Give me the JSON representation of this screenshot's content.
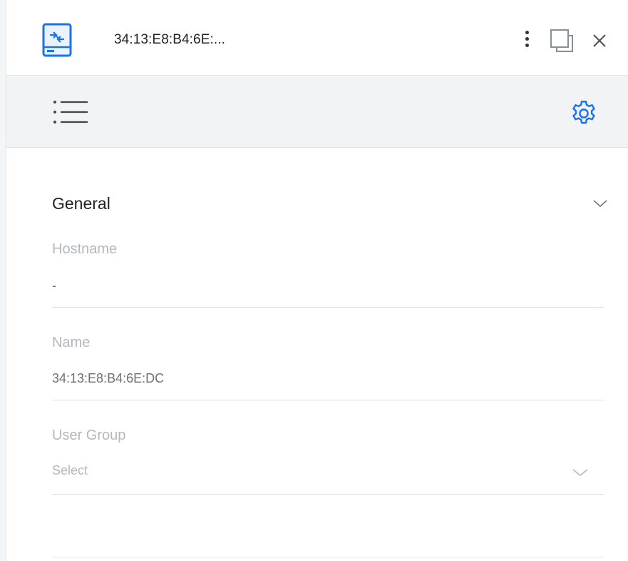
{
  "header": {
    "title": "34:13:E8:B4:6E:...",
    "device_icon": "network-device-icon",
    "menu_icon": "kebab-menu-icon",
    "restore_icon": "restore-window-icon",
    "close_icon": "close-icon"
  },
  "toolbar": {
    "list_icon": "list-view-icon",
    "settings_icon": "gear-icon",
    "accent_color": "#1a73e8"
  },
  "section": {
    "title": "General",
    "expanded": true
  },
  "fields": {
    "hostname": {
      "label": "Hostname",
      "value": "-"
    },
    "name": {
      "label": "Name",
      "value": "34:13:E8:B4:6E:DC"
    },
    "user_group": {
      "label": "User Group",
      "placeholder": "Select"
    }
  }
}
